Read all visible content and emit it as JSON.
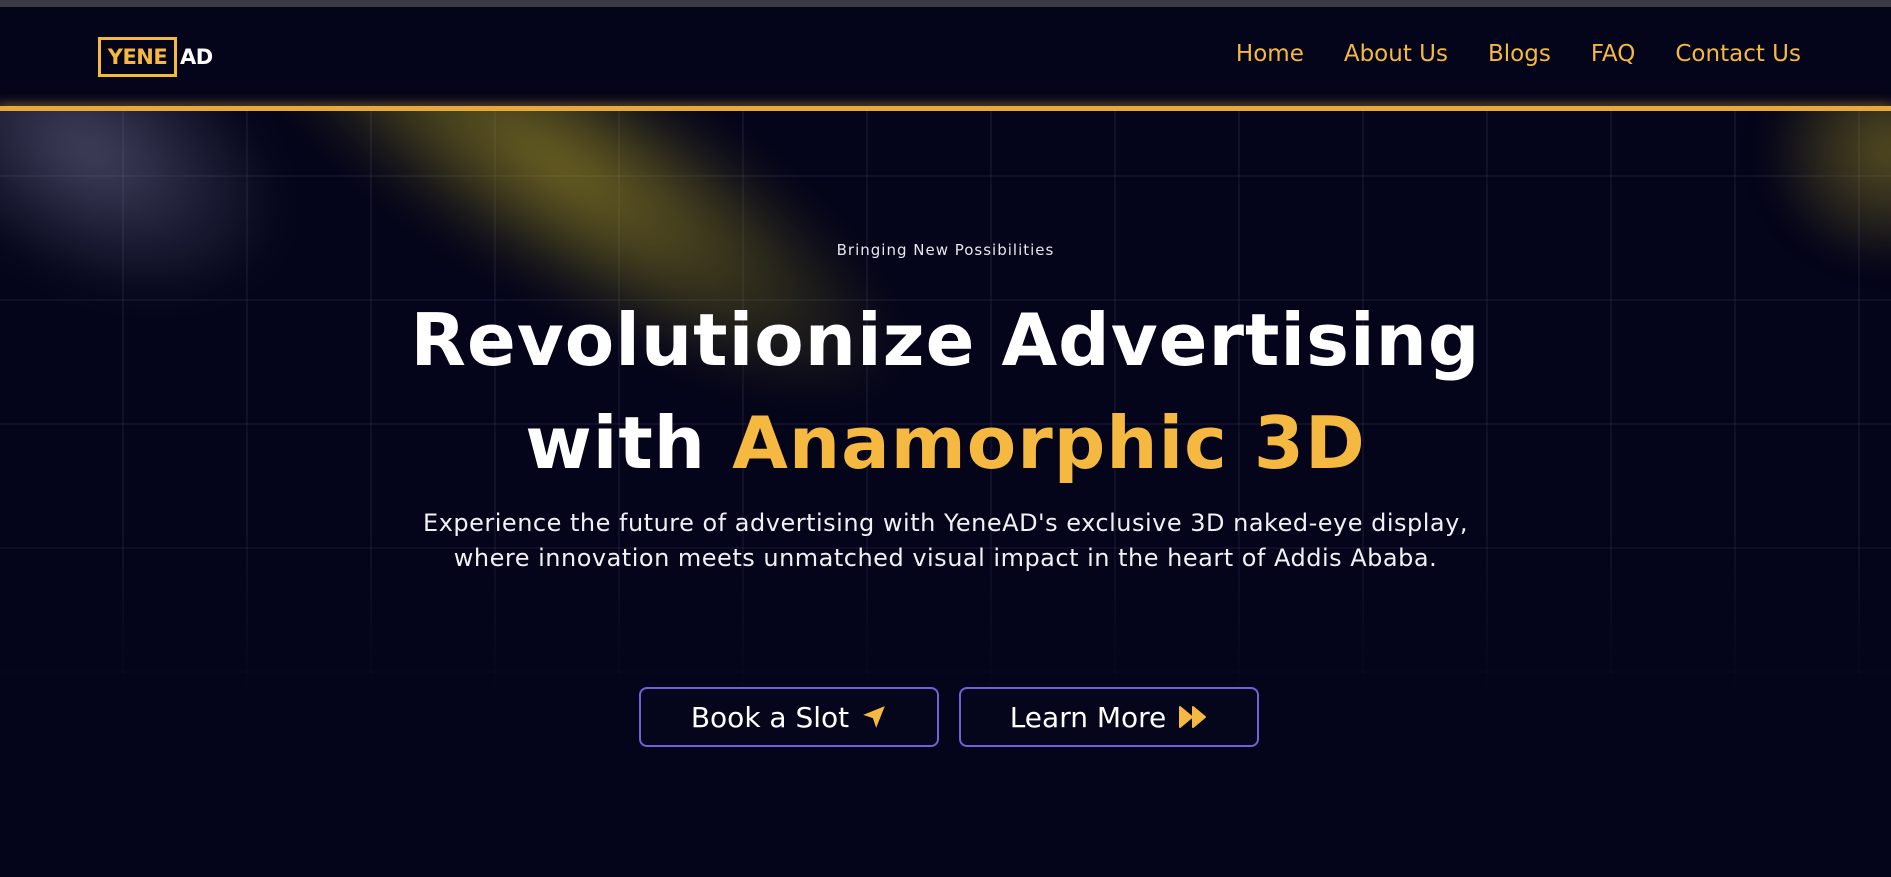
{
  "brand": {
    "logo_box_text": "YENE",
    "logo_suffix": "AD"
  },
  "nav": {
    "items": [
      {
        "label": "Home"
      },
      {
        "label": "About Us"
      },
      {
        "label": "Blogs"
      },
      {
        "label": "FAQ"
      },
      {
        "label": "Contact Us"
      }
    ]
  },
  "hero": {
    "kicker": "Bringing New Possibilities",
    "headline_line1": "Revolutionize Advertising",
    "headline_line2_prefix": "with",
    "headline_line2_accent": "Anamorphic 3D",
    "subtext_line1": "Experience the future of advertising with YeneAD's exclusive 3D naked-eye display,",
    "subtext_line2": "where innovation meets unmatched visual impact in the heart of Addis Ababa."
  },
  "buttons": {
    "book": {
      "label": "Book a Slot",
      "icon": "paper-plane-icon"
    },
    "learn": {
      "label": "Learn More",
      "icon": "fast-forward-icon"
    }
  },
  "colors": {
    "background": "#04041a",
    "accent": "#f5b942",
    "button_border": "#6e64d6",
    "text": "#ffffff"
  }
}
